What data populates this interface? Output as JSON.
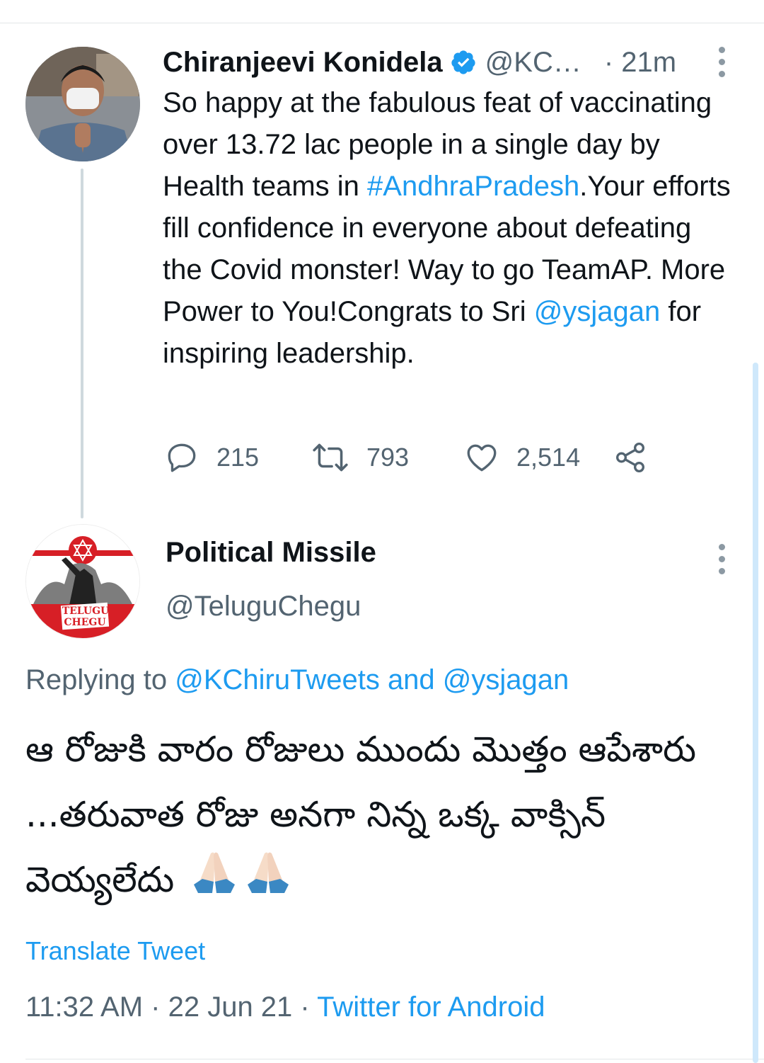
{
  "parent_tweet": {
    "display_name": "Chiranjeevi Konidela",
    "handle": "@KC…",
    "time": "· 21m",
    "text_parts": [
      "So happy at the fabulous feat of vaccinating over 13.72 lac people in a single day by Health teams in ",
      "#AndhraPradesh",
      ".Your efforts fill confidence in everyone about defeating the Covid monster! Way to go TeamAP. More Power to You!Congrats to Sri ",
      "@ysjagan",
      " for  inspiring leadership."
    ],
    "stats": {
      "replies": "215",
      "retweets": "793",
      "likes": "2,514"
    },
    "icons": {
      "verified": "verified-badge-icon",
      "more": "more-options-icon"
    }
  },
  "reply_tweet": {
    "display_name": "Political Missile",
    "handle": "@TeluguChegu",
    "avatar_text": [
      "TELUGU",
      "CHEGU"
    ],
    "replying_prefix": "Replying to ",
    "replying_to": "@KChiruTweets and @ysjagan",
    "text": "ఆ రోజుకి వారం రోజులు ముందు మొత్తం ఆపేశారు ...తరువాత రోజు అనగా నిన్న ఒక్క వాక్సిన్ వెయ్యలేదు",
    "emoji": "folded-hands-icon",
    "translate_label": "Translate Tweet",
    "meta": {
      "time": "11:32 AM",
      "separator": " · ",
      "date": "22 Jun 21",
      "source": "Twitter for Android"
    }
  },
  "colors": {
    "link": "#1d9bf0",
    "secondary_text": "#536471",
    "primary_text": "#0f1419",
    "brand_red": "#d71f26"
  }
}
